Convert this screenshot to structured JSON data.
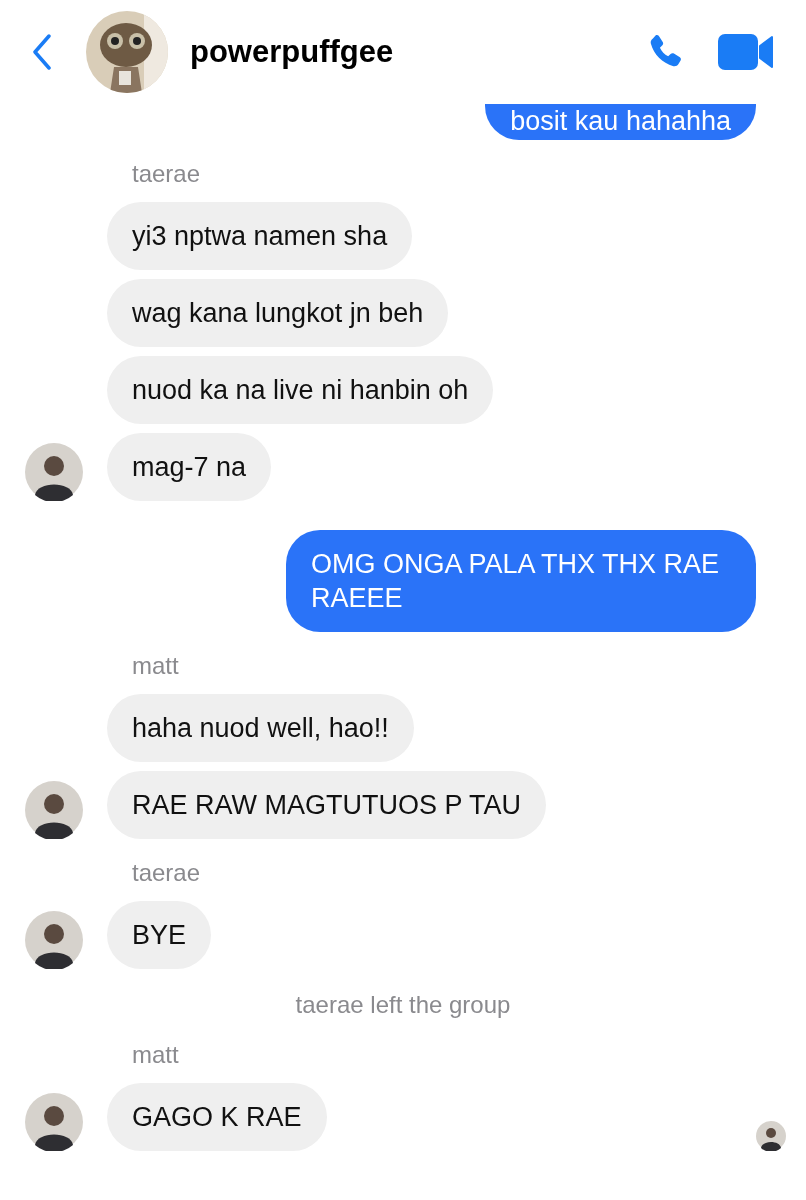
{
  "header": {
    "title": "powerpuffgee"
  },
  "messages": [
    {
      "kind": "outgoing",
      "text": "bosit kau hahahha"
    },
    {
      "kind": "sender",
      "text": "taerae"
    },
    {
      "kind": "incoming",
      "text": "yi3 nptwa namen sha",
      "avatar": false,
      "seen": false
    },
    {
      "kind": "incoming",
      "text": "wag kana lungkot jn beh",
      "avatar": false,
      "seen": false
    },
    {
      "kind": "incoming",
      "text": "nuod ka na live ni hanbin oh",
      "avatar": false,
      "seen": false
    },
    {
      "kind": "incoming",
      "text": "mag-7 na",
      "avatar": true,
      "seen": false
    },
    {
      "kind": "outgoing",
      "text": "OMG ONGA PALA THX THX RAE RAEEE"
    },
    {
      "kind": "sender",
      "text": "matt"
    },
    {
      "kind": "incoming",
      "text": "haha nuod well, hao!!",
      "avatar": false,
      "seen": false
    },
    {
      "kind": "incoming",
      "text": "RAE RAW MAGTUTUOS P TAU",
      "avatar": true,
      "seen": false
    },
    {
      "kind": "sender",
      "text": "taerae"
    },
    {
      "kind": "incoming",
      "text": "BYE",
      "avatar": true,
      "seen": false
    },
    {
      "kind": "system",
      "text": "taerae left the group"
    },
    {
      "kind": "sender",
      "text": "matt"
    },
    {
      "kind": "incoming",
      "text": "GAGO K RAE",
      "avatar": true,
      "seen": true
    }
  ]
}
